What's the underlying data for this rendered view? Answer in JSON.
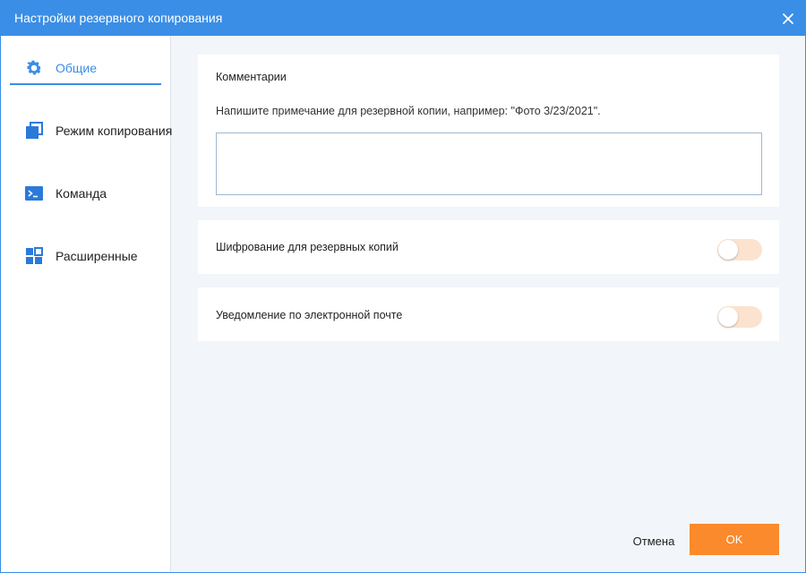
{
  "window": {
    "title": "Настройки резервного копирования",
    "close_icon": "close-icon"
  },
  "sidebar": {
    "items": [
      {
        "label": "Общие",
        "icon": "gear-icon",
        "active": true
      },
      {
        "label": "Режим копирования",
        "icon": "copy-mode-icon",
        "active": false
      },
      {
        "label": "Команда",
        "icon": "terminal-icon",
        "active": false
      },
      {
        "label": "Расширенные",
        "icon": "grid-icon",
        "active": false
      }
    ]
  },
  "comments": {
    "title": "Комментарии",
    "hint": "Напишите примечание для резервной копии, например: \"Фото 3/23/2021\".",
    "value": ""
  },
  "encryption": {
    "label": "Шифрование для резервных копий",
    "enabled": false
  },
  "email": {
    "label": "Уведомление по электронной почте",
    "enabled": false
  },
  "footer": {
    "cancel_label": "Отмена",
    "ok_label": "OK"
  },
  "colors": {
    "accent": "#3a8ee6",
    "ok_button": "#fa8a2b",
    "toggle_off": "#fbe3cf",
    "background": "#f2f5f9"
  }
}
